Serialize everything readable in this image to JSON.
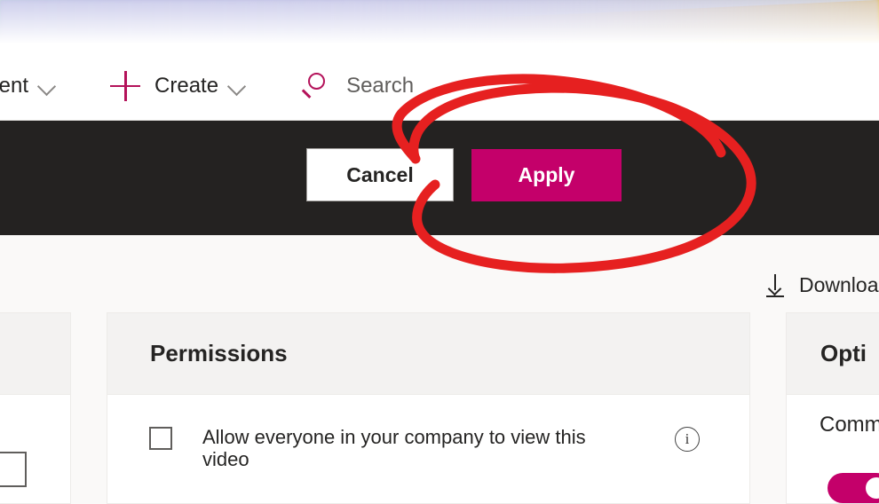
{
  "app": {
    "background_color": "#faf9f8",
    "accent_color": "#c4006a",
    "commandbar_color": "#242221",
    "annotation_color": "#e62020"
  },
  "banner": {
    "name": "decorative-gradient-banner",
    "colors": [
      "#e4a208",
      "#f7de3c",
      "#96d7cd",
      "#a8a7dd",
      "#ffffff"
    ]
  },
  "navbar": {
    "content_menu": {
      "label": "tent",
      "chevron": "chevron-down-icon"
    },
    "create_menu": {
      "icon": "plus-icon",
      "label": "Create",
      "chevron": "chevron-down-icon"
    },
    "search": {
      "icon": "search-icon",
      "label": "Search"
    }
  },
  "commandbar": {
    "cancel_label": "Cancel",
    "apply_label": "Apply"
  },
  "content": {
    "download": {
      "icon": "download-icon",
      "label": "Downloa"
    },
    "panels": {
      "left": {
        "title": "",
        "checkbox_checked": false
      },
      "permissions": {
        "title": "Permissions",
        "checkbox": {
          "label": "Allow everyone in your company to view this video",
          "checked": false
        },
        "info_icon": "info-icon",
        "info_glyph": "i"
      },
      "options": {
        "title": "Opti",
        "setting_label": "Comm",
        "toggle_on": true
      }
    }
  },
  "annotation": {
    "shape": "hand-drawn-ellipse",
    "target": "Apply",
    "color": "#e62020"
  }
}
